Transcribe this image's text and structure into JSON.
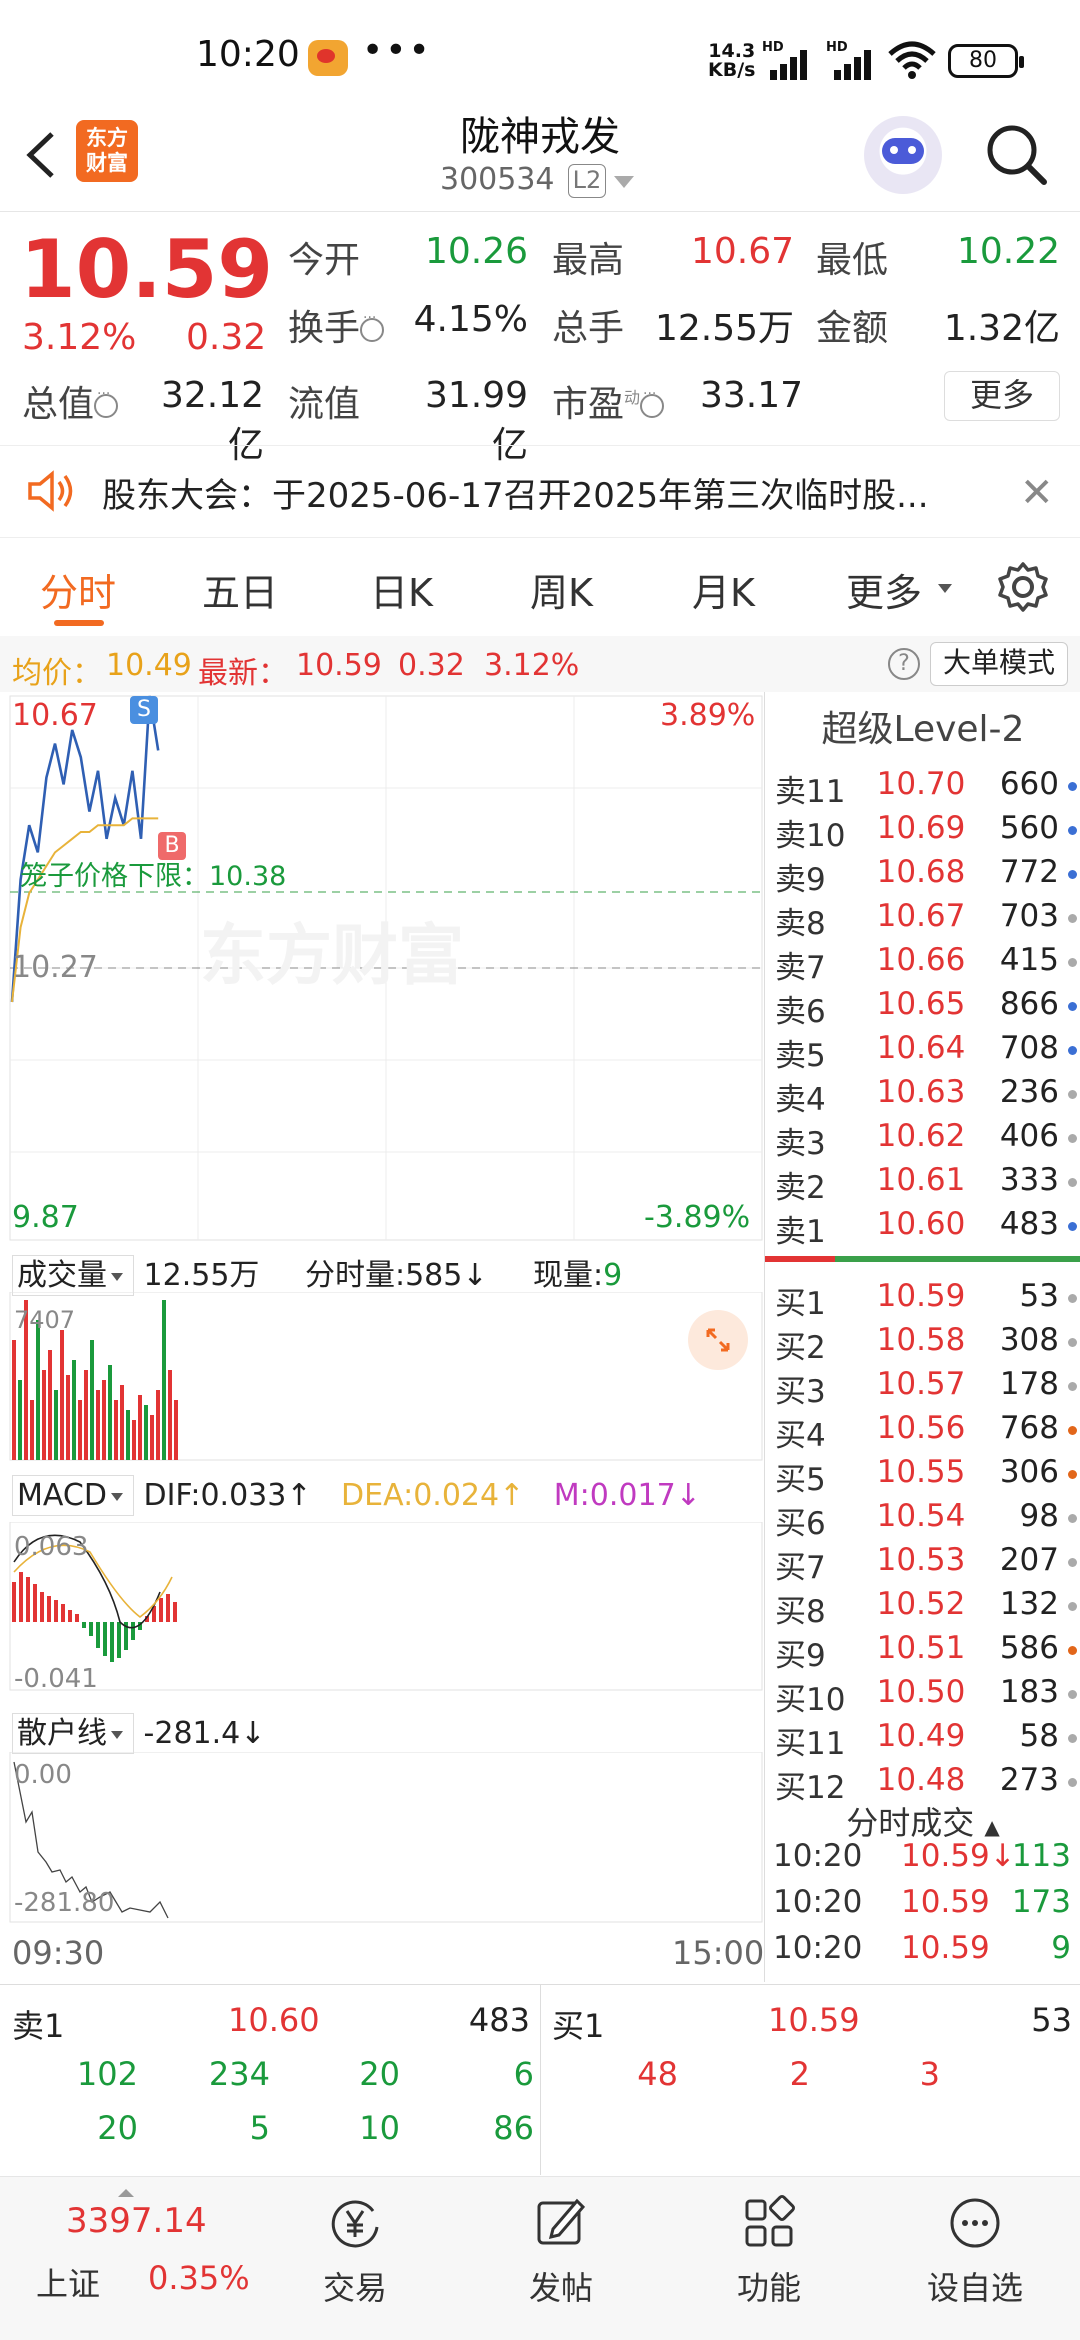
{
  "status_bar": {
    "time": "10:20",
    "dots": "•••",
    "net_speed_value": "14.3",
    "net_speed_unit": "KB/s",
    "hd1": "HD",
    "hd2": "HD",
    "battery": "80",
    "icons": [
      "weibo-icon",
      "signal-icon",
      "wifi-icon",
      "battery-icon"
    ]
  },
  "header": {
    "logo_line1": "东方",
    "logo_line2": "财富",
    "stock_name": "陇神戎发",
    "stock_code": "300534",
    "badge": "L2"
  },
  "quote": {
    "price": "10.59",
    "change_pct": "3.12%",
    "change": "0.32",
    "open_label": "今开",
    "open": "10.26",
    "high_label": "最高",
    "high": "10.67",
    "low_label": "最低",
    "low": "10.22",
    "turnover_rate_label": "换手",
    "turnover_rate": "4.15%",
    "volume_label": "总手",
    "volume": "12.55万",
    "amount_label": "金额",
    "amount": "1.32亿",
    "total_mv_label": "总值",
    "total_mv": "32.12亿",
    "float_mv_label": "流值",
    "float_mv": "31.99亿",
    "pe_label": "市盈",
    "pe_sup": "动",
    "pe": "33.17",
    "more_button": "更多"
  },
  "notice": {
    "text": "股东大会：于2025-06-17召开2025年第三次临时股..."
  },
  "tabs": {
    "items": [
      "分时",
      "五日",
      "日K",
      "周K",
      "月K",
      "更多"
    ],
    "active": 0
  },
  "avg_row": {
    "avg_label": "均价：",
    "avg_value": "10.49",
    "latest_label": "最新：",
    "latest_value": "10.59",
    "change": "0.32",
    "change_pct": "3.12%",
    "big_order_button": "大单模式"
  },
  "chart": {
    "y_top": "10.67",
    "y_mid": "10.27",
    "y_bottom": "9.87",
    "pct_top": "3.89%",
    "pct_bottom": "-3.89%",
    "lower_limit_label": "笼子价格下限：10.38",
    "marker_s": "S",
    "marker_b": "B",
    "watermark": "东方财富",
    "volume_label": "成交量",
    "volume_total": "12.55万",
    "tick_volume_label": "分时量:585↓",
    "now_volume_label": "现量:",
    "now_volume": "9",
    "volume_max": "7407",
    "macd_label": "MACD",
    "dif": "DIF:0.033↑",
    "dea": "DEA:0.024↑",
    "m": "M:0.017↓",
    "macd_top": "0.063",
    "macd_bottom": "-0.041",
    "retail_label": "散户线",
    "retail_value": "-281.4↓",
    "retail_top": "0.00",
    "retail_bottom": "-281.80",
    "time_start": "09:30",
    "time_end": "15:00"
  },
  "chart_data": {
    "type": "line",
    "x_range": [
      "09:30",
      "15:00"
    ],
    "ylim": [
      9.87,
      10.67
    ],
    "series": [
      {
        "values": [
          10.22,
          10.4,
          10.48,
          10.44,
          10.55,
          10.6,
          10.54,
          10.62,
          10.58,
          10.5,
          10.56,
          10.46,
          10.52,
          10.48,
          10.56,
          10.46,
          10.67,
          10.59
        ]
      },
      {
        "values": [
          10.22,
          10.33,
          10.38,
          10.4,
          10.42,
          10.44,
          10.45,
          10.46,
          10.47,
          10.47,
          10.48,
          10.48,
          10.48,
          10.48,
          10.49,
          10.49,
          10.49,
          10.49
        ]
      }
    ]
  },
  "order_book": {
    "title": "超级Level-2",
    "asks": [
      {
        "label": "卖11",
        "price": "10.70",
        "vol": "660",
        "dot": "#3b6fd4"
      },
      {
        "label": "卖10",
        "price": "10.69",
        "vol": "560",
        "dot": "#3b6fd4"
      },
      {
        "label": "卖9",
        "price": "10.68",
        "vol": "772",
        "dot": "#3b6fd4"
      },
      {
        "label": "卖8",
        "price": "10.67",
        "vol": "703",
        "dot": "#aaaaaa"
      },
      {
        "label": "卖7",
        "price": "10.66",
        "vol": "415",
        "dot": "#aaaaaa"
      },
      {
        "label": "卖6",
        "price": "10.65",
        "vol": "866",
        "dot": "#3b6fd4"
      },
      {
        "label": "卖5",
        "price": "10.64",
        "vol": "708",
        "dot": "#3b6fd4"
      },
      {
        "label": "卖4",
        "price": "10.63",
        "vol": "236",
        "dot": "#aaaaaa"
      },
      {
        "label": "卖3",
        "price": "10.62",
        "vol": "406",
        "dot": "#aaaaaa"
      },
      {
        "label": "卖2",
        "price": "10.61",
        "vol": "333",
        "dot": "#aaaaaa"
      },
      {
        "label": "卖1",
        "price": "10.60",
        "vol": "483",
        "dot": "#3b6fd4"
      }
    ],
    "bids": [
      {
        "label": "买1",
        "price": "10.59",
        "vol": "53",
        "dot": "#aaaaaa"
      },
      {
        "label": "买2",
        "price": "10.58",
        "vol": "308",
        "dot": "#aaaaaa"
      },
      {
        "label": "买3",
        "price": "10.57",
        "vol": "178",
        "dot": "#aaaaaa"
      },
      {
        "label": "买4",
        "price": "10.56",
        "vol": "768",
        "dot": "#e2661a"
      },
      {
        "label": "买5",
        "price": "10.55",
        "vol": "306",
        "dot": "#e2661a"
      },
      {
        "label": "买6",
        "price": "10.54",
        "vol": "98",
        "dot": "#aaaaaa"
      },
      {
        "label": "买7",
        "price": "10.53",
        "vol": "207",
        "dot": "#aaaaaa"
      },
      {
        "label": "买8",
        "price": "10.52",
        "vol": "132",
        "dot": "#aaaaaa"
      },
      {
        "label": "买9",
        "price": "10.51",
        "vol": "586",
        "dot": "#e2661a"
      },
      {
        "label": "买10",
        "price": "10.50",
        "vol": "183",
        "dot": "#aaaaaa"
      },
      {
        "label": "买11",
        "price": "10.49",
        "vol": "58",
        "dot": "#aaaaaa"
      },
      {
        "label": "买12",
        "price": "10.48",
        "vol": "273",
        "dot": "#aaaaaa"
      }
    ],
    "trades_title": "分时成交",
    "trades": [
      {
        "time": "10:20",
        "price": "10.59↓",
        "vol": "113",
        "color": "#1a9a3c"
      },
      {
        "time": "10:20",
        "price": "10.59",
        "vol": "173",
        "color": "#1a9a3c"
      },
      {
        "time": "10:20",
        "price": "10.59",
        "vol": "9",
        "color": "#1a9a3c"
      }
    ]
  },
  "summary": {
    "sell_label": "卖1",
    "sell_price": "10.60",
    "sell_vol": "483",
    "buy_label": "买1",
    "buy_price": "10.59",
    "buy_vol": "53",
    "sell_queue_row1": [
      "102",
      "234",
      "20",
      "6"
    ],
    "sell_queue_row2": [
      "20",
      "5",
      "10",
      "86"
    ],
    "buy_queue_row1": [
      "48",
      "2",
      "3"
    ]
  },
  "bottom_nav": {
    "index_value": "3397.14",
    "index_name": "上证",
    "index_change": "0.35%",
    "items": [
      "交易",
      "发帖",
      "功能",
      "设自选"
    ]
  },
  "colors": {
    "up": "#e23434",
    "down": "#1a9a3c",
    "accent": "#f26a21",
    "price_line": "#2f5fb3",
    "avg_line": "#e8b33a"
  }
}
